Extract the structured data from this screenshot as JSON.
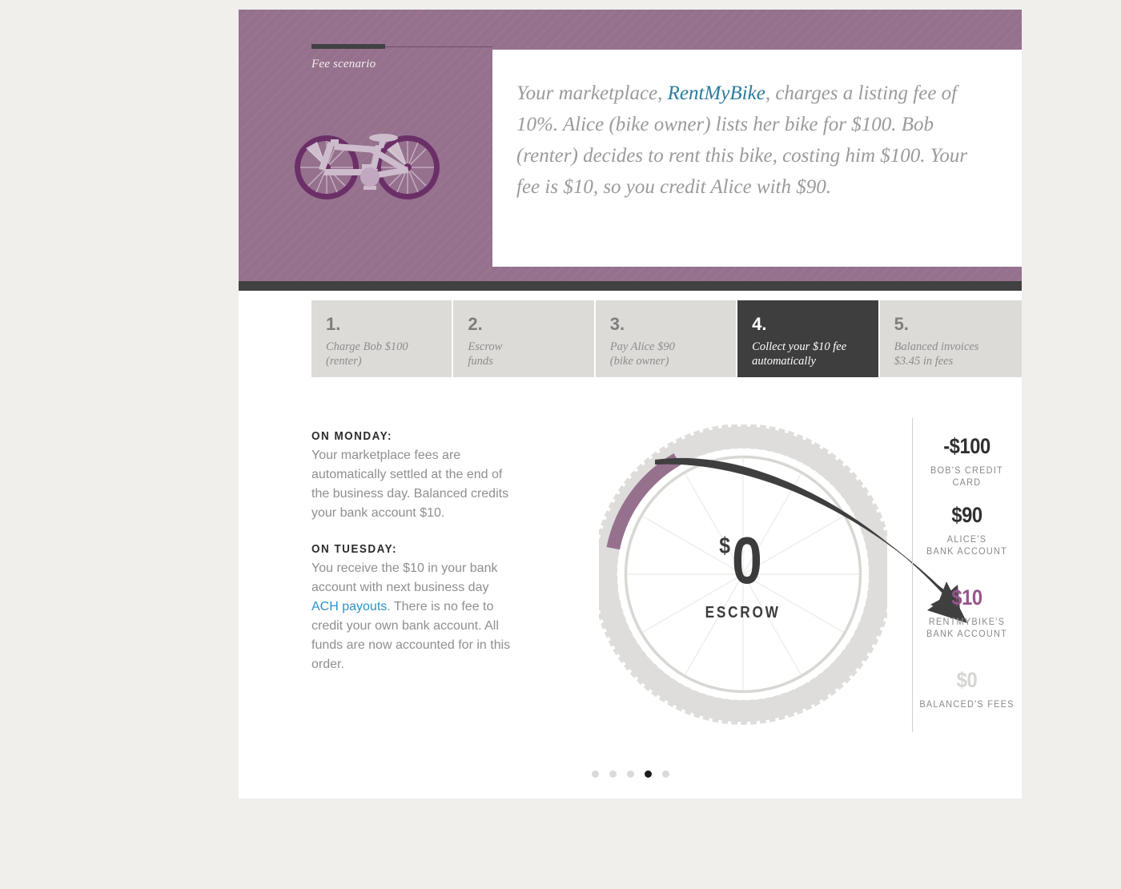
{
  "hero": {
    "eyebrow": "Fee scenario",
    "progress_percent": 41,
    "illustration": "bicycle-illustration",
    "quote": {
      "before": "Your marketplace, ",
      "brand": "RentMyBike",
      "after": ", charges a listing fee of 10%. Alice (bike owner) lists her bike for $100. Bob (renter) decides to rent this bike, costing him $100. Your fee is $10, so you credit Alice with $90."
    }
  },
  "steps": [
    {
      "num": "1.",
      "label": "Charge Bob $100\n(renter)",
      "active": false
    },
    {
      "num": "2.",
      "label": "Escrow\nfunds",
      "active": false
    },
    {
      "num": "3.",
      "label": "Pay Alice $90\n(bike owner)",
      "active": false
    },
    {
      "num": "4.",
      "label": "Collect your $10 fee\nautomatically",
      "active": true
    },
    {
      "num": "5.",
      "label": "Balanced invoices\n$3.45 in fees",
      "active": false
    }
  ],
  "copy": {
    "monday_heading": "ON MONDAY:",
    "monday_body": "Your marketplace fees are automatically settled at the end of the business day. Balanced credits your bank account $10.",
    "tuesday_heading": "ON TUESDAY:",
    "tuesday_body_before": "You receive the $10 in your bank account with next business day ",
    "tuesday_link": "ACH payouts",
    "tuesday_body_after": ". There is no fee to credit your own bank account. All funds are now accounted for in this order."
  },
  "escrow": {
    "currency": "$",
    "amount": "0",
    "label": "ESCROW",
    "segment_percent": 14
  },
  "amounts": [
    {
      "value": "-$100",
      "caption": "BOB'S CREDIT CARD",
      "style": "dark"
    },
    {
      "value": "$90",
      "caption": "ALICE'S\nBANK ACCOUNT",
      "style": "dark"
    },
    {
      "value": "$10",
      "caption": "RENTMYBIKE'S\nBANK ACCOUNT",
      "style": "purple"
    },
    {
      "value": "$0",
      "caption": "BALANCED'S FEES",
      "style": "muted"
    }
  ],
  "pagination": {
    "count": 5,
    "active_index": 3
  },
  "colors": {
    "purple": "#96718e",
    "purple_accent": "#96558c",
    "dark": "#3e3e3e",
    "link": "#2a93c9",
    "brand_link": "#2a7b9b",
    "page_bg": "#f0efec"
  }
}
